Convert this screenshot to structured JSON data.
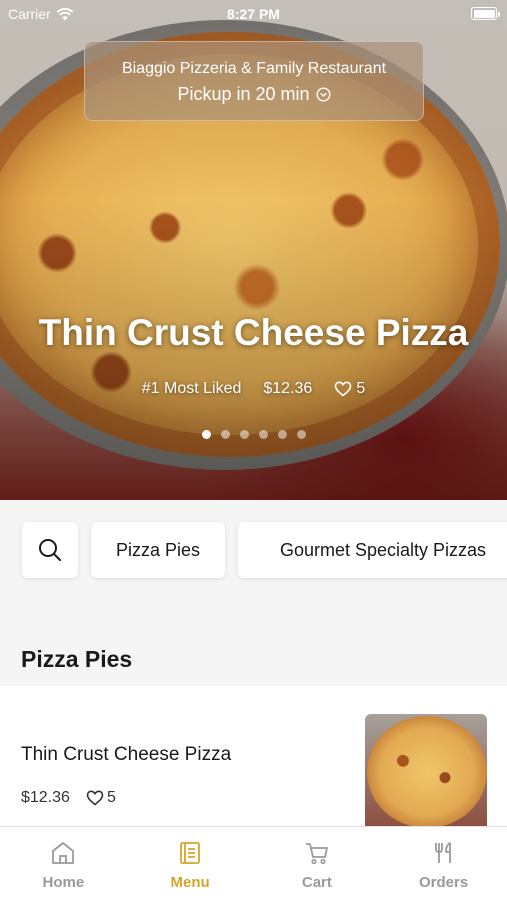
{
  "status_bar": {
    "carrier": "Carrier",
    "time": "8:27 PM"
  },
  "hero": {
    "restaurant_name": "Biaggio Pizzeria & Family Restaurant",
    "pickup_text": "Pickup in 20 min",
    "title": "Thin Crust Cheese Pizza",
    "rank": "#1 Most Liked",
    "price": "$12.36",
    "likes": "5",
    "carousel": {
      "total": 6,
      "active_index": 0
    }
  },
  "categories": {
    "search_icon": "search-icon",
    "items": [
      "Pizza Pies",
      "Gourmet Specialty Pizzas"
    ]
  },
  "section": {
    "title": "Pizza Pies",
    "items": [
      {
        "name": "Thin Crust Cheese Pizza",
        "price": "$12.36",
        "likes": "5"
      }
    ]
  },
  "tab_bar": {
    "active": "Menu",
    "active_color": "#d4a52a",
    "inactive_color": "#9a9a9a",
    "tabs": [
      {
        "label": "Home",
        "icon": "home-icon"
      },
      {
        "label": "Menu",
        "icon": "menu-icon"
      },
      {
        "label": "Cart",
        "icon": "cart-icon"
      },
      {
        "label": "Orders",
        "icon": "orders-icon"
      }
    ]
  }
}
